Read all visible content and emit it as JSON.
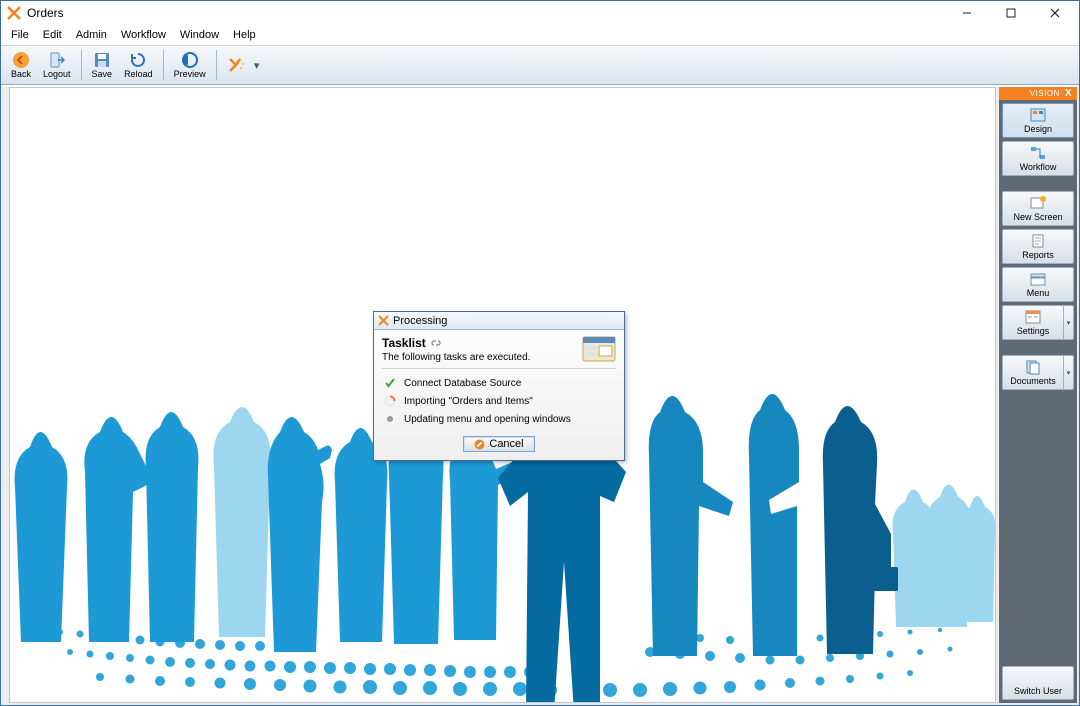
{
  "window": {
    "title": "Orders"
  },
  "menu": {
    "file": "File",
    "edit": "Edit",
    "admin": "Admin",
    "workflow": "Workflow",
    "window": "Window",
    "help": "Help"
  },
  "toolbar": {
    "back": "Back",
    "logout": "Logout",
    "save": "Save",
    "reload": "Reload",
    "preview": "Preview"
  },
  "sidebar": {
    "tab": "VISION",
    "design": "Design",
    "workflow": "Workflow",
    "new_screen": "New Screen",
    "reports": "Reports",
    "menu": "Menu",
    "settings": "Settings",
    "documents": "Documents",
    "switch_user": "Switch User"
  },
  "dialog": {
    "title": "Processing",
    "heading": "Tasklist",
    "subtitle": "The following tasks are executed.",
    "task1": "Connect Database Source",
    "task2": "Importing \"Orders and Items\"",
    "task3": "Updating menu and opening windows",
    "cancel": "Cancel"
  }
}
